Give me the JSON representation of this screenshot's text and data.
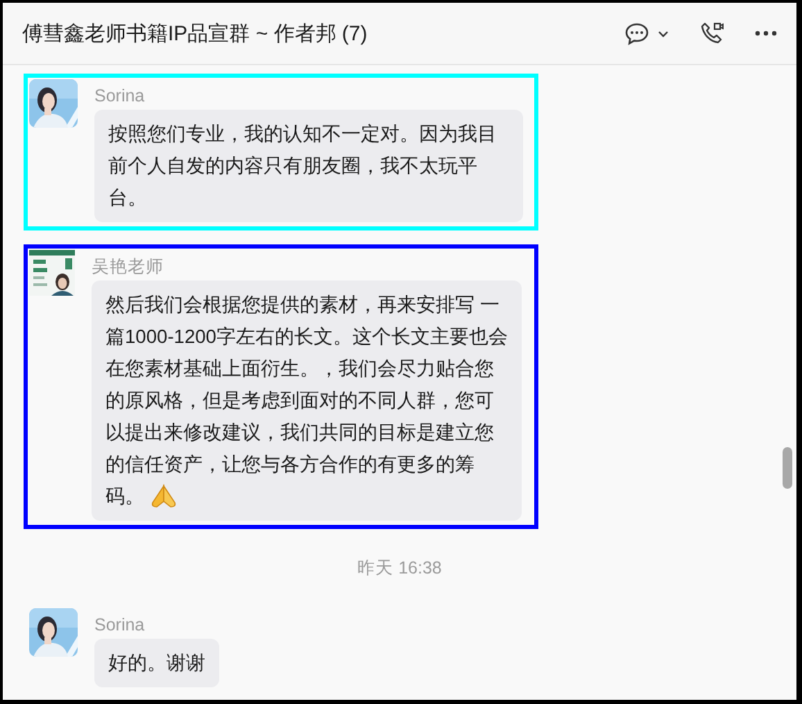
{
  "window": {
    "title": "傅彗鑫老师书籍IP品宣群 ~ 作者邦 (7)"
  },
  "messages": [
    {
      "kind": "message",
      "sender": "Sorina",
      "text": "按照您们专业，我的认知不一定对。因为我目前个人自发的内容只有朋友圈，我不太玩平台。",
      "has_emoji": false,
      "color": "#00ffff"
    },
    {
      "kind": "message",
      "sender": "吴艳老师",
      "text": "然后我们会根据您提供的素材，再来安排写 一篇1000-1200字左右的长文。这个长文主要也会在您素材基础上面衍生。，我们会尽力贴合您的原风格，但是考虑到面对的不同人群，您可以提出来修改建议，我们共同的目标是建立您的信任资产，让您与各方合作的有更多的筹码。",
      "has_emoji": true,
      "color": "#0000ff"
    },
    {
      "kind": "time",
      "text": "昨天 16:38"
    },
    {
      "kind": "message",
      "sender": "Sorina",
      "text": "好的。谢谢",
      "has_emoji": false
    }
  ]
}
